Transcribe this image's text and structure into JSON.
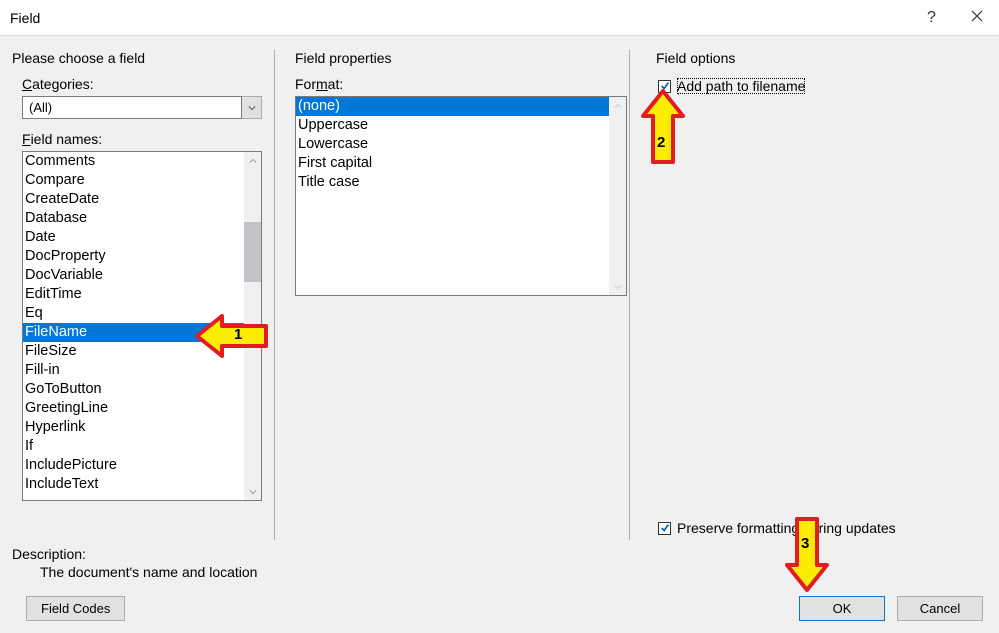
{
  "titlebar": {
    "title": "Field",
    "help_icon": "?",
    "close_icon": "x"
  },
  "left": {
    "group_label": "Please choose a field",
    "categories_label_pre": "C",
    "categories_label_post": "ategories:",
    "categories_value": "(All)",
    "fieldnames_label_pre": "F",
    "fieldnames_label_post": "ield names:",
    "fieldnames": [
      "Comments",
      "Compare",
      "CreateDate",
      "Database",
      "Date",
      "DocProperty",
      "DocVariable",
      "EditTime",
      "Eq",
      "FileName",
      "FileSize",
      "Fill-in",
      "GoToButton",
      "GreetingLine",
      "Hyperlink",
      "If",
      "IncludePicture",
      "IncludeText"
    ],
    "selected_index": 9
  },
  "mid": {
    "group_label": "Field properties",
    "format_label_pre": "For",
    "format_label_u": "m",
    "format_label_post": "at:",
    "formats": [
      "(none)",
      "Uppercase",
      "Lowercase",
      "First capital",
      "Title case"
    ],
    "selected_index": 0
  },
  "right": {
    "group_label": "Field options",
    "addpath_label": "Add path to filename",
    "preserve_label_pre": "Preser",
    "preserve_label_u": "v",
    "preserve_label_post": "e formatting during updates"
  },
  "description": {
    "label": "Description:",
    "text": "The document's name and location"
  },
  "footer": {
    "field_codes_label": "Field Codes",
    "ok_label": "OK",
    "cancel_label": "Cancel"
  },
  "annotations": {
    "a1": "1",
    "a2": "2",
    "a3": "3"
  }
}
